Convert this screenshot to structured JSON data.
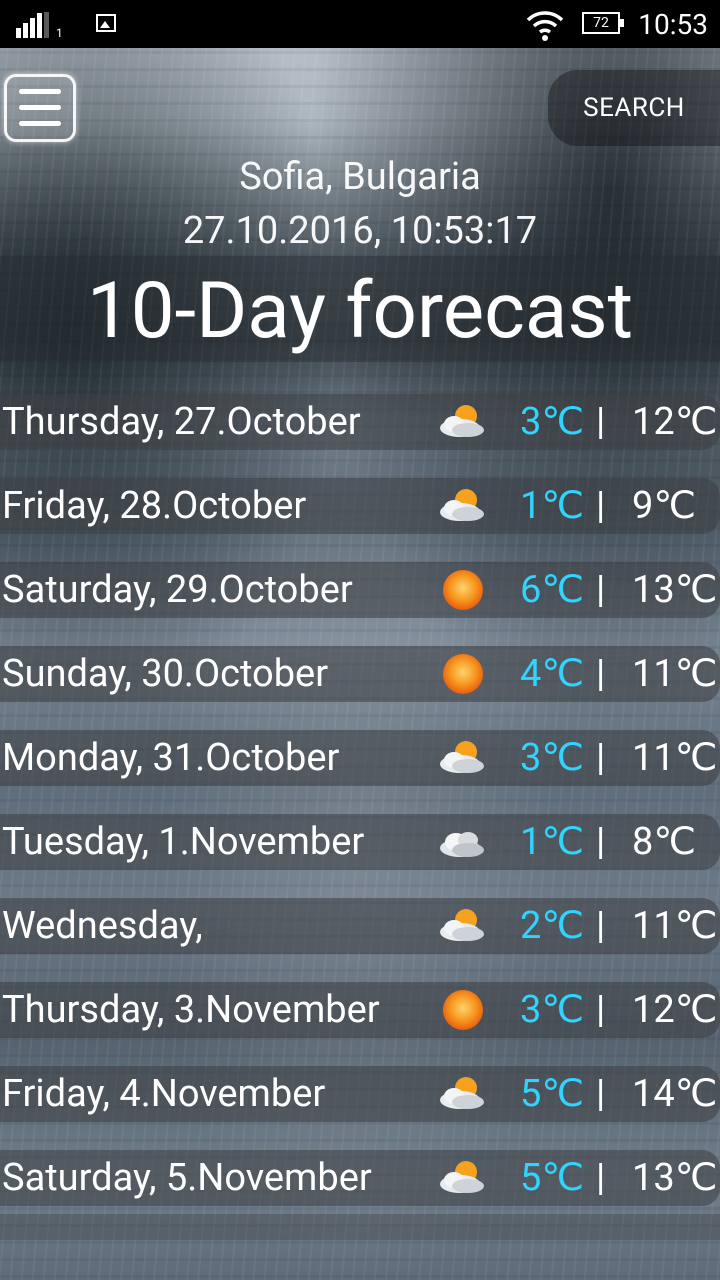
{
  "status_bar": {
    "sim": "1",
    "battery": "72",
    "time": "10:53"
  },
  "header": {
    "menu_icon": "hamburger-menu-icon",
    "search_label": "SEARCH",
    "location": "Sofia, Bulgaria",
    "datetime": "27.10.2016, 10:53:17",
    "title": "10-Day forecast"
  },
  "colors": {
    "low_temp": "#2fd4ff",
    "high_temp": "#ffffff"
  },
  "forecast": [
    {
      "day": "Thursday, 27.October",
      "icon": "partly-cloudy-icon",
      "low": "3℃",
      "high": "12℃"
    },
    {
      "day": "Friday, 28.October",
      "icon": "partly-cloudy-icon",
      "low": "1℃",
      "high": "9℃"
    },
    {
      "day": "Saturday, 29.October",
      "icon": "sun-icon",
      "low": "6℃",
      "high": "13℃"
    },
    {
      "day": "Sunday, 30.October",
      "icon": "sun-icon",
      "low": "4℃",
      "high": "11℃"
    },
    {
      "day": "Monday, 31.October",
      "icon": "partly-cloudy-icon",
      "low": "3℃",
      "high": "11℃"
    },
    {
      "day": "Tuesday, 1.November",
      "icon": "cloud-icon",
      "low": "1℃",
      "high": "8℃"
    },
    {
      "day": "Wednesday,",
      "icon": "partly-cloudy-icon",
      "low": "2℃",
      "high": "11℃"
    },
    {
      "day": "Thursday, 3.November",
      "icon": "sun-icon",
      "low": "3℃",
      "high": "12℃"
    },
    {
      "day": "Friday, 4.November",
      "icon": "partly-cloudy-icon",
      "low": "5℃",
      "high": "14℃"
    },
    {
      "day": "Saturday, 5.November",
      "icon": "partly-cloudy-icon",
      "low": "5℃",
      "high": "13℃"
    }
  ],
  "separator": "|"
}
